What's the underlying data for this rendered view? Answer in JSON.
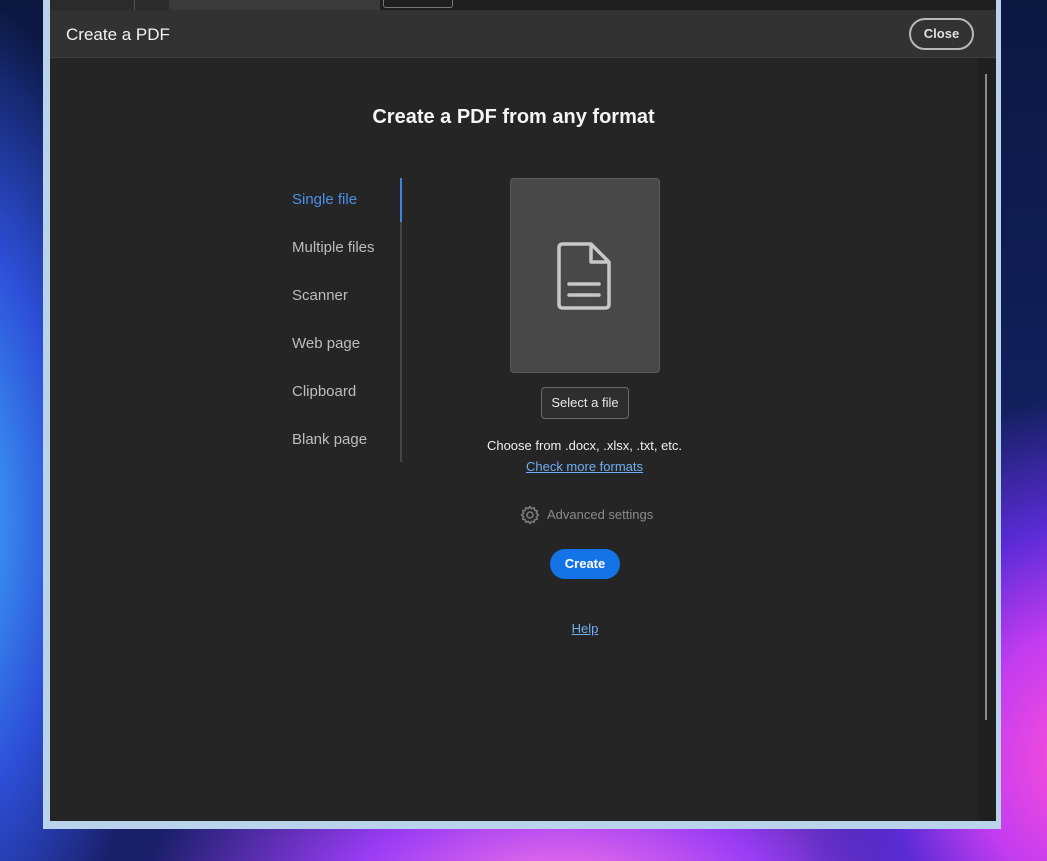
{
  "dialog": {
    "title": "Create a PDF",
    "close_label": "Close"
  },
  "main": {
    "heading": "Create a PDF from any format",
    "nav_items": [
      {
        "label": "Single file",
        "active": true
      },
      {
        "label": "Multiple files",
        "active": false
      },
      {
        "label": "Scanner",
        "active": false
      },
      {
        "label": "Web page",
        "active": false
      },
      {
        "label": "Clipboard",
        "active": false
      },
      {
        "label": "Blank page",
        "active": false
      }
    ],
    "select_file_label": "Select a file",
    "formats_text": "Choose from .docx, .xlsx, .txt, etc.",
    "more_formats_link": "Check more formats",
    "advanced_settings_label": "Advanced settings",
    "create_label": "Create",
    "help_link": "Help"
  },
  "icons": {
    "file": "document-icon",
    "settings": "gear-icon"
  },
  "colors": {
    "accent": "#1473e6",
    "active_nav": "#4b8fe8",
    "link": "#6fb0f5",
    "background": "#252525"
  }
}
